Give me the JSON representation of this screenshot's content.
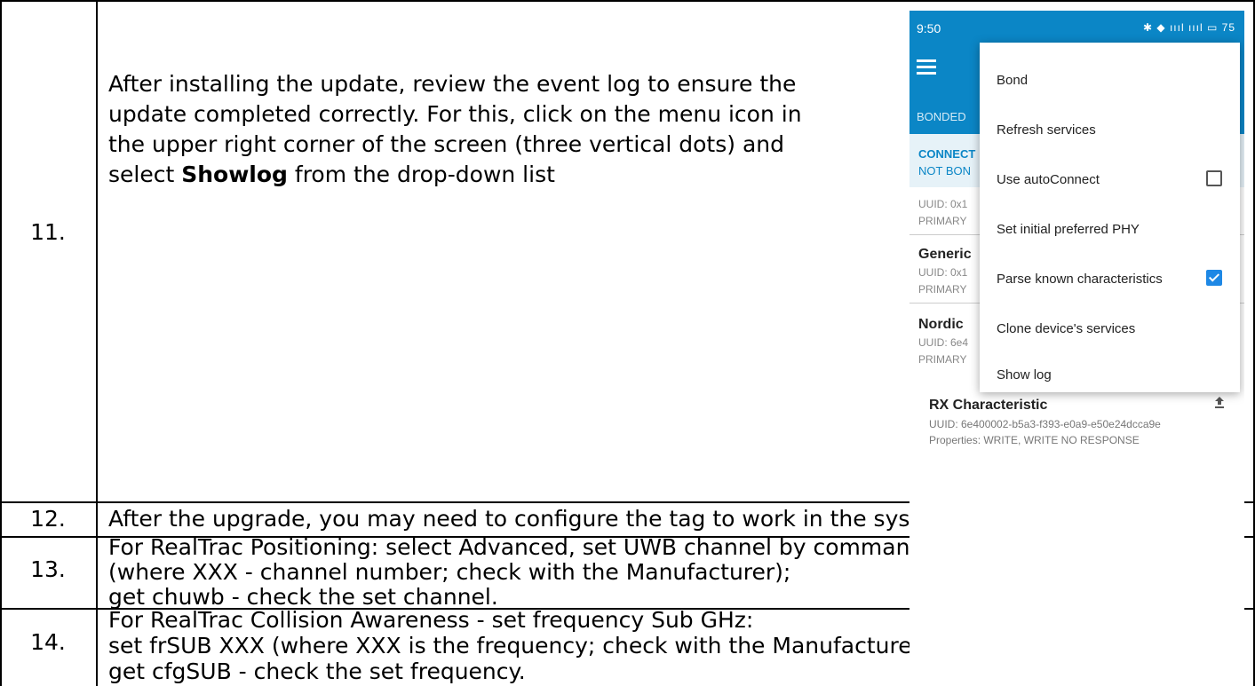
{
  "rows": [
    {
      "number": "11.",
      "lines": [
        "After installing the update, review the event log to ensure the",
        "update completed correctly. For this, click on the menu icon in",
        "the upper right corner of the screen (three vertical dots) and"
      ],
      "last_line_prefix": "select ",
      "last_line_bold": "Showlog",
      "last_line_suffix": " from the drop-down list"
    },
    {
      "number": "12.",
      "lines": [
        "After the upgrade, you may need to configure the tag to work in the system."
      ]
    },
    {
      "number": "13.",
      "lines": [
        "For RealTrac Positioning: select Advanced, set UWB channel by command set chUWB XXX",
        "(where XXX - channel number; check with the Manufacturer);",
        "get chuwb - check the set channel."
      ]
    },
    {
      "number": "14.",
      "lines": [
        "For RealTrac Collision Awareness - set frequency Sub GHz:",
        "set frSUB XXX (where XXX is the frequency; check with the Manufacturer);",
        "get cfgSUB - check the set frequency."
      ]
    }
  ],
  "phone": {
    "status_time": "9:50",
    "status_icons_text": "✱ ◆ ıııl ıııl ▭ 75",
    "tab_label": "BONDED",
    "connection_status": "CONNECT",
    "bond_status": "NOT BON",
    "services": [
      {
        "name": "",
        "uuid": "UUID: 0x1",
        "type": "PRIMARY"
      },
      {
        "name": "Generic",
        "uuid": "UUID: 0x1",
        "type": "PRIMARY"
      },
      {
        "name": "Nordic",
        "uuid": "UUID: 6e4",
        "type": "PRIMARY"
      }
    ],
    "characteristic": {
      "name": "RX Characteristic",
      "uuid": "UUID: 6e400002-b5a3-f393-e0a9-e50e24dcca9e",
      "properties": "Properties: WRITE, WRITE NO RESPONSE"
    },
    "menu": [
      {
        "label": "Bond"
      },
      {
        "label": "Refresh services"
      },
      {
        "label": "Use autoConnect",
        "checkbox": "unchecked"
      },
      {
        "label": "Set initial preferred PHY"
      },
      {
        "label": "Parse known characteristics",
        "checkbox": "checked"
      },
      {
        "label": "Clone device's services"
      },
      {
        "label": "Show log"
      }
    ],
    "colors": {
      "appbar": "#0b86c6",
      "checkbox_checked": "#1e88e5"
    }
  }
}
